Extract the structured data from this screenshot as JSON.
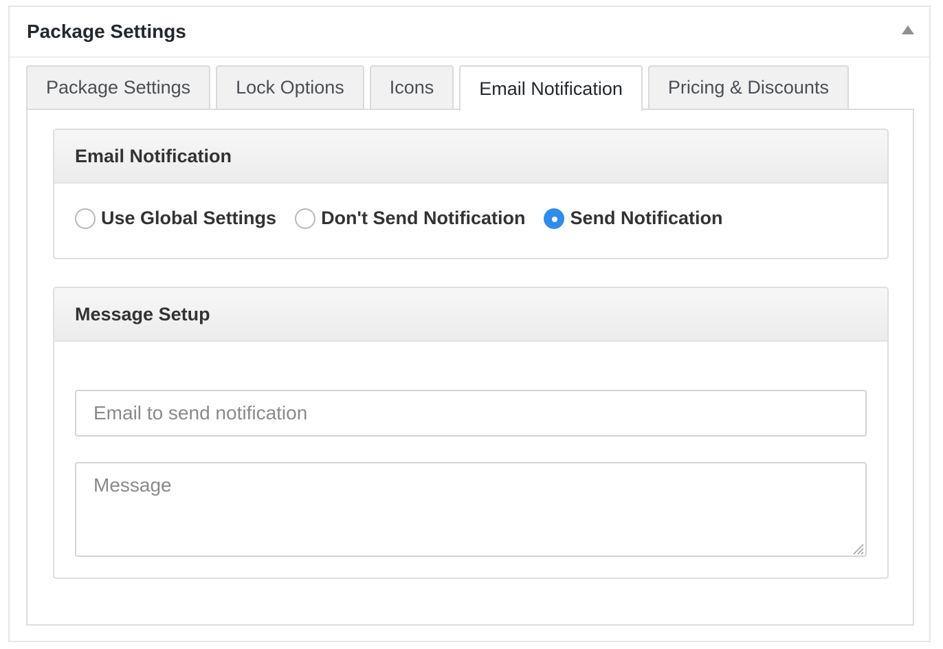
{
  "metabox": {
    "title": "Package Settings",
    "toggle_icon": "triangle-up-icon"
  },
  "tabs": [
    {
      "label": "Package Settings",
      "active": false
    },
    {
      "label": "Lock Options",
      "active": false
    },
    {
      "label": "Icons",
      "active": false
    },
    {
      "label": "Email Notification",
      "active": true
    },
    {
      "label": "Pricing & Discounts",
      "active": false
    }
  ],
  "email_notification": {
    "title": "Email Notification",
    "options": [
      {
        "label": "Use Global Settings",
        "checked": false
      },
      {
        "label": "Don't Send Notification",
        "checked": false
      },
      {
        "label": "Send Notification",
        "checked": true
      }
    ]
  },
  "message_setup": {
    "title": "Message Setup",
    "email_placeholder": "Email to send notification",
    "email_value": "",
    "message_placeholder": "Message",
    "message_value": ""
  },
  "colors": {
    "accent": "#2d8cf0",
    "border": "#dedede",
    "panel_header": "#f1f1f1"
  }
}
